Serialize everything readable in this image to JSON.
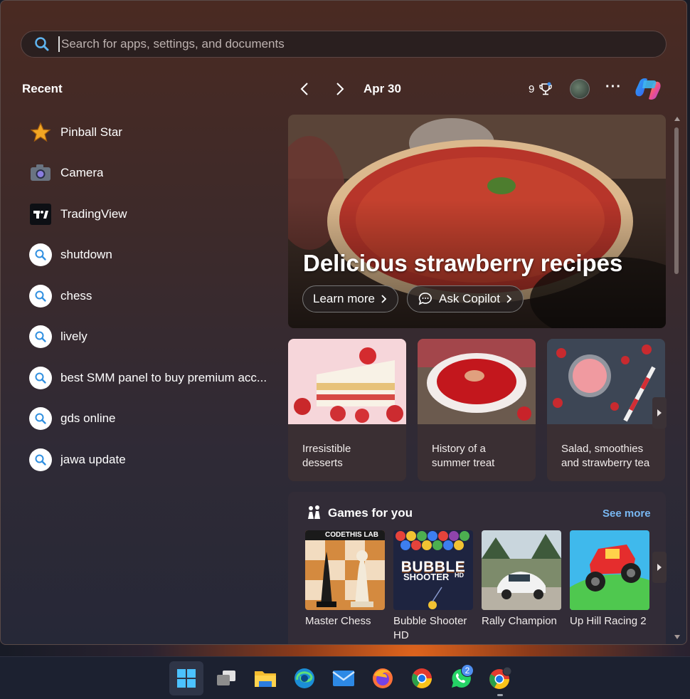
{
  "search": {
    "placeholder": "Search for apps, settings, and documents",
    "icon": "search-icon"
  },
  "recent": {
    "title": "Recent",
    "items": [
      {
        "label": "Pinball Star",
        "icon": "star-icon"
      },
      {
        "label": "Camera",
        "icon": "camera-icon"
      },
      {
        "label": "TradingView",
        "icon": "tradingview-icon"
      },
      {
        "label": "shutdown",
        "icon": "search-icon"
      },
      {
        "label": "chess",
        "icon": "search-icon"
      },
      {
        "label": "lively",
        "icon": "search-icon"
      },
      {
        "label": "best SMM panel to buy premium acc...",
        "icon": "search-icon"
      },
      {
        "label": "gds online",
        "icon": "search-icon"
      },
      {
        "label": "jawa update",
        "icon": "search-icon"
      }
    ]
  },
  "header": {
    "date": "Apr 30",
    "points": "9",
    "more": "···"
  },
  "hero": {
    "title": "Delicious strawberry recipes",
    "learn_more": "Learn more",
    "ask_copilot": "Ask Copilot"
  },
  "cards": [
    {
      "label": "Irresistible desserts"
    },
    {
      "label": "History of a summer treat"
    },
    {
      "label": "Salad, smoothies and strawberry tea"
    }
  ],
  "games": {
    "title": "Games for you",
    "see_more": "See more",
    "items": [
      {
        "name": "Master Chess",
        "badge": "CODETHIS LAB"
      },
      {
        "name": "Bubble Shooter HD",
        "art_line1": "BUBBLE",
        "art_line2": "SHOOTER",
        "art_hd": "HD"
      },
      {
        "name": "Rally Champion"
      },
      {
        "name": "Up Hill Racing 2"
      }
    ]
  },
  "taskbar": {
    "items": [
      "windows-start-icon",
      "task-view-icon",
      "file-explorer-icon",
      "edge-icon",
      "mail-icon",
      "firefox-icon",
      "chrome-icon",
      "whatsapp-icon",
      "chrome-profile-icon"
    ],
    "whatsapp_badge": "2"
  },
  "colors": {
    "accent": "#79b8f2",
    "badge": "#4f8ff0"
  }
}
